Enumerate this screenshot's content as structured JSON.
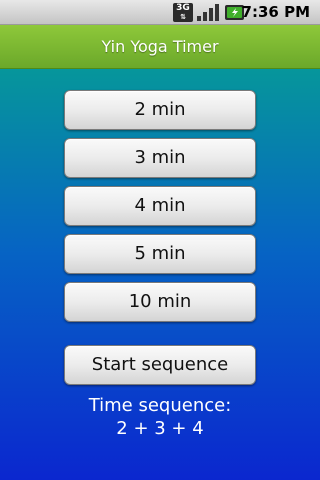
{
  "status_bar": {
    "network_label": "3G",
    "time": "7:36 PM",
    "icons": [
      "3g-data-icon",
      "signal-strength-icon",
      "battery-charging-icon"
    ]
  },
  "title_bar": {
    "title": "Yin Yoga Timer",
    "color": "#7ab832"
  },
  "timer_buttons": [
    {
      "label": "2 min"
    },
    {
      "label": "3 min"
    },
    {
      "label": "4 min"
    },
    {
      "label": "5 min"
    },
    {
      "label": "10 min"
    }
  ],
  "start_button": {
    "label": "Start sequence"
  },
  "sequence": {
    "label": "Time sequence:",
    "value": "2 + 3 + 4"
  },
  "colors": {
    "background_top": "#06969b",
    "background_bottom": "#0b27cf",
    "text": "#ffffff"
  }
}
